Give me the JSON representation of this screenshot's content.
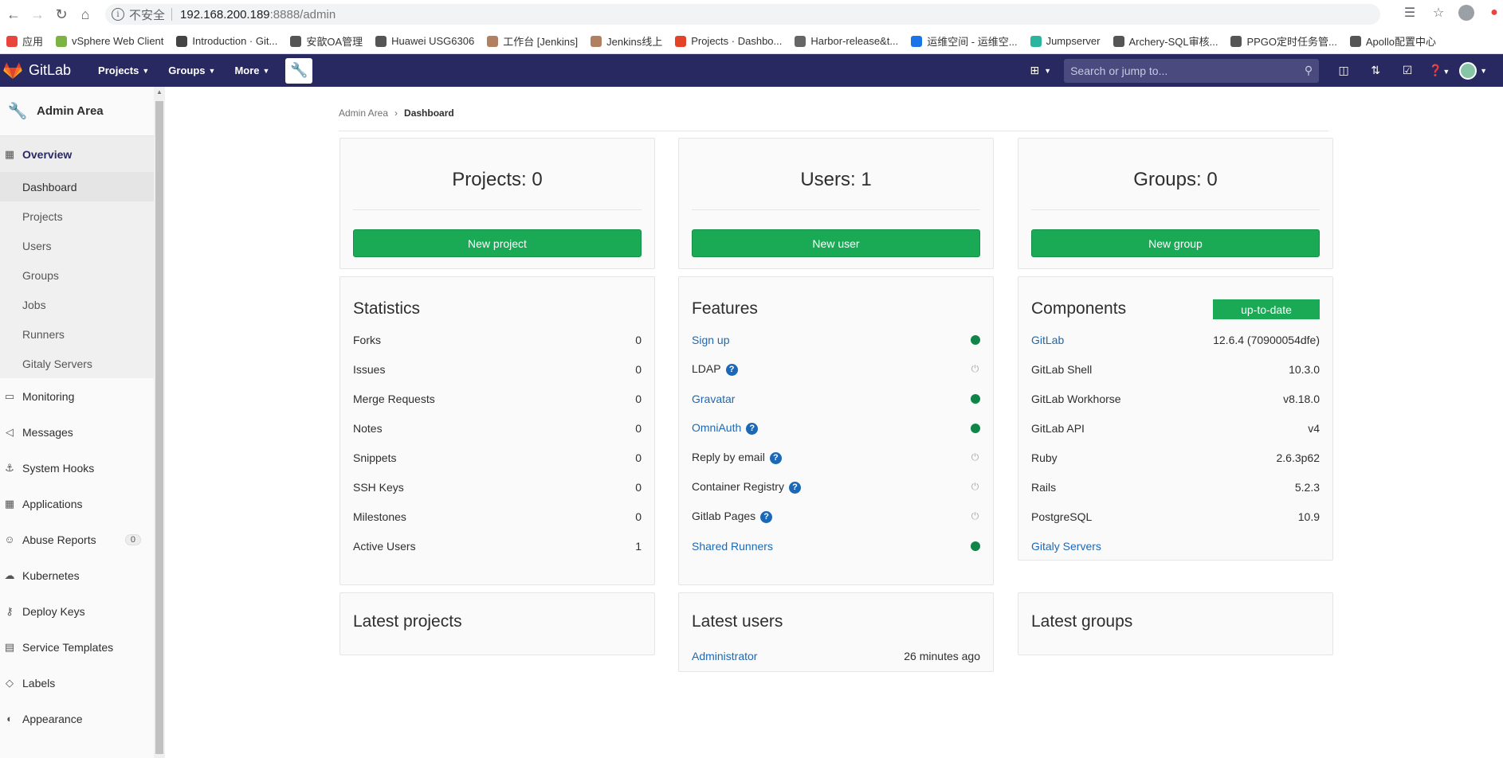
{
  "browser": {
    "insecure_label": "不安全",
    "url_host": "192.168.200.189",
    "url_port_path": ":8888/admin",
    "bookmarks": [
      {
        "label": "应用",
        "color": "#e8453c"
      },
      {
        "label": "vSphere Web Client",
        "color": "#7cb342"
      },
      {
        "label": "Introduction · Git...",
        "color": "#444444"
      },
      {
        "label": "安歆OA管理",
        "color": "#555555"
      },
      {
        "label": "Huawei USG6306",
        "color": "#555555"
      },
      {
        "label": "工作台 [Jenkins]",
        "color": "#b08060"
      },
      {
        "label": "Jenkins线上",
        "color": "#b08060"
      },
      {
        "label": "Projects · Dashbo...",
        "color": "#e24329"
      },
      {
        "label": "Harbor-release&t...",
        "color": "#666666"
      },
      {
        "label": "运维空间 - 运维空...",
        "color": "#1a73e8"
      },
      {
        "label": "Jumpserver",
        "color": "#2bb5a0"
      },
      {
        "label": "Archery-SQL审核...",
        "color": "#555555"
      },
      {
        "label": "PPGO定时任务管...",
        "color": "#555555"
      },
      {
        "label": "Apollo配置中心",
        "color": "#555555"
      }
    ]
  },
  "header": {
    "logo_text": "GitLab",
    "nav": [
      {
        "label": "Projects"
      },
      {
        "label": "Groups"
      },
      {
        "label": "More"
      }
    ],
    "search_placeholder": "Search or jump to..."
  },
  "sidebar": {
    "context_title": "Admin Area",
    "overview_label": "Overview",
    "overview_items": [
      "Dashboard",
      "Projects",
      "Users",
      "Groups",
      "Jobs",
      "Runners",
      "Gitaly Servers"
    ],
    "items": [
      {
        "label": "Monitoring",
        "icon": "monitor-icon"
      },
      {
        "label": "Messages",
        "icon": "megaphone-icon"
      },
      {
        "label": "System Hooks",
        "icon": "hook-icon"
      },
      {
        "label": "Applications",
        "icon": "applications-icon"
      },
      {
        "label": "Abuse Reports",
        "icon": "abuse-icon",
        "badge": "0"
      },
      {
        "label": "Kubernetes",
        "icon": "kubernetes-icon"
      },
      {
        "label": "Deploy Keys",
        "icon": "key-icon"
      },
      {
        "label": "Service Templates",
        "icon": "template-icon"
      },
      {
        "label": "Labels",
        "icon": "label-icon"
      },
      {
        "label": "Appearance",
        "icon": "appearance-icon"
      }
    ]
  },
  "breadcrumb": {
    "parent": "Admin Area",
    "current": "Dashboard"
  },
  "stats_cards": [
    {
      "title": "Projects: 0",
      "button": "New project"
    },
    {
      "title": "Users: 1",
      "button": "New user"
    },
    {
      "title": "Groups: 0",
      "button": "New group"
    }
  ],
  "statistics": {
    "title": "Statistics",
    "rows": [
      {
        "label": "Forks",
        "value": "0"
      },
      {
        "label": "Issues",
        "value": "0"
      },
      {
        "label": "Merge Requests",
        "value": "0"
      },
      {
        "label": "Notes",
        "value": "0"
      },
      {
        "label": "Snippets",
        "value": "0"
      },
      {
        "label": "SSH Keys",
        "value": "0"
      },
      {
        "label": "Milestones",
        "value": "0"
      },
      {
        "label": "Active Users",
        "value": "1"
      }
    ]
  },
  "features": {
    "title": "Features",
    "rows": [
      {
        "label": "Sign up",
        "link": true,
        "help": false,
        "enabled": true
      },
      {
        "label": "LDAP",
        "link": false,
        "help": true,
        "enabled": false
      },
      {
        "label": "Gravatar",
        "link": true,
        "help": false,
        "enabled": true
      },
      {
        "label": "OmniAuth",
        "link": true,
        "help": true,
        "enabled": true
      },
      {
        "label": "Reply by email",
        "link": false,
        "help": true,
        "enabled": false
      },
      {
        "label": "Container Registry",
        "link": false,
        "help": true,
        "enabled": false
      },
      {
        "label": "Gitlab Pages",
        "link": false,
        "help": true,
        "enabled": false
      },
      {
        "label": "Shared Runners",
        "link": true,
        "help": false,
        "enabled": true
      }
    ]
  },
  "components": {
    "title": "Components",
    "badge": "up-to-date",
    "rows": [
      {
        "label": "GitLab",
        "value": "12.6.4 (70900054dfe)",
        "link": true
      },
      {
        "label": "GitLab Shell",
        "value": "10.3.0",
        "link": false
      },
      {
        "label": "GitLab Workhorse",
        "value": "v8.18.0",
        "link": false
      },
      {
        "label": "GitLab API",
        "value": "v4",
        "link": false
      },
      {
        "label": "Ruby",
        "value": "2.6.3p62",
        "link": false
      },
      {
        "label": "Rails",
        "value": "5.2.3",
        "link": false
      },
      {
        "label": "PostgreSQL",
        "value": "10.9",
        "link": false
      },
      {
        "label": "Gitaly Servers",
        "value": "",
        "link": true
      }
    ]
  },
  "latest": {
    "projects_title": "Latest projects",
    "users_title": "Latest users",
    "groups_title": "Latest groups",
    "users": [
      {
        "name": "Administrator",
        "time": "26 minutes ago"
      }
    ]
  }
}
